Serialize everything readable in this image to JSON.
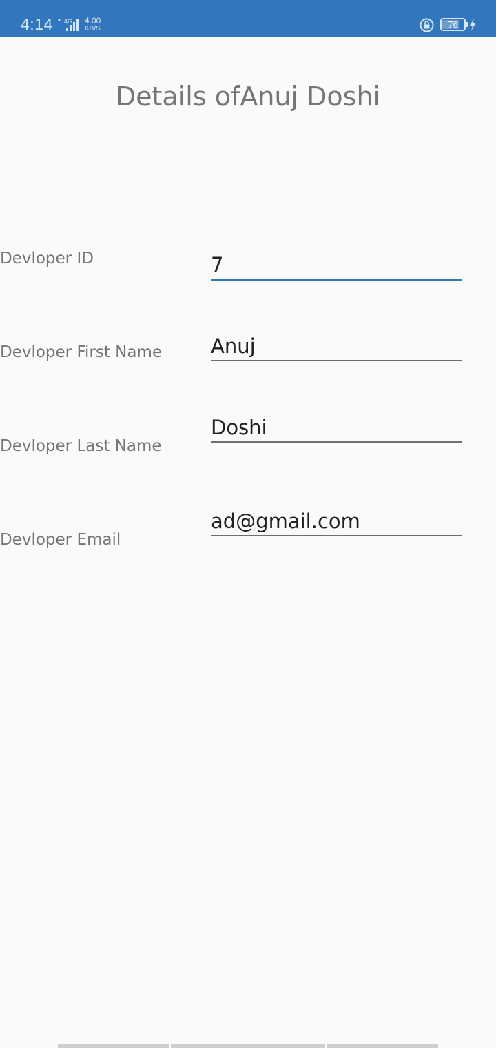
{
  "status_bar": {
    "time": "4:14",
    "network_type": "4G",
    "speed_value": "4.00",
    "speed_unit": "KB/S",
    "battery_level": "76",
    "icons": [
      "signal-icon",
      "lock-rotation-icon",
      "battery-icon",
      "charging-bolt-icon"
    ],
    "background_color": "#3277bd"
  },
  "page": {
    "title": "Details ofAnuj Doshi"
  },
  "form": {
    "developer_id": {
      "label": "Devloper ID",
      "value": "7"
    },
    "first_name": {
      "label": "Devloper First Name",
      "value": "Anuj"
    },
    "last_name": {
      "label": "Devloper Last Name",
      "value": "Doshi"
    },
    "email": {
      "label": "Devloper Email",
      "value": "ad@gmail.com"
    }
  },
  "colors": {
    "accent": "#3277bd",
    "label_text": "#757575",
    "input_text": "#212121",
    "background": "#fafafa"
  }
}
